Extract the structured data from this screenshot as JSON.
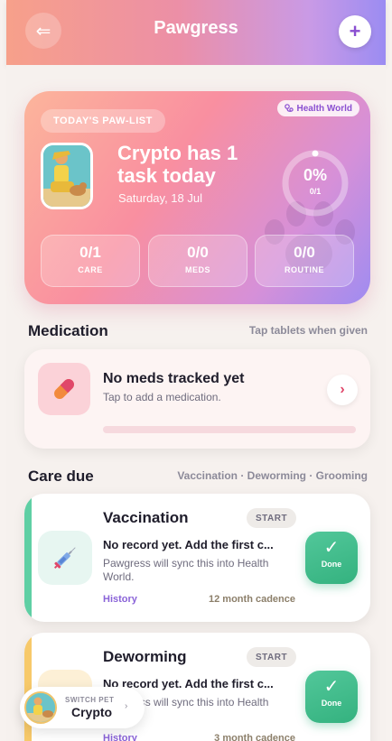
{
  "header": {
    "title": "Pawgress",
    "back_icon": "arrow-left-icon",
    "add_icon": "plus-icon",
    "add_label": "+"
  },
  "hero": {
    "pill": "TODAY'S PAW-LIST",
    "badge": "Health World",
    "title": "Crypto has 1 task today",
    "date": "Saturday, 18 Jul",
    "progress_pct": "0%",
    "progress_sub": "0/1",
    "progress_fraction": 0,
    "stats": [
      {
        "value": "0/1",
        "label": "CARE"
      },
      {
        "value": "0/0",
        "label": "MEDS"
      },
      {
        "value": "0/0",
        "label": "ROUTINE"
      }
    ]
  },
  "medication": {
    "section_title": "Medication",
    "section_hint": "Tap tablets when given",
    "card_title": "No meds tracked yet",
    "card_sub": "Tap to add a medication.",
    "chevron": "›"
  },
  "care": {
    "section_title": "Care due",
    "section_hint": "Vaccination · Deworming · Grooming",
    "items": [
      {
        "title": "Vaccination",
        "status": "START",
        "line1": "No record yet. Add the first c...",
        "line2": "Pawgress will sync this into Health World.",
        "history": "History",
        "cadence": "12 month cadence",
        "done": "Done",
        "tick": "✓",
        "icon": "syringe-icon",
        "accent": "#5fcfa4"
      },
      {
        "title": "Deworming",
        "status": "START",
        "line1": "No record yet. Add the first c...",
        "line2": "Pawgress will sync this into Health World.",
        "history": "History",
        "cadence": "3 month cadence",
        "done": "Done",
        "tick": "✓",
        "icon": "deworm-icon",
        "accent": "#f7c96a"
      }
    ]
  },
  "switch_pet": {
    "label": "SWITCH PET",
    "name": "Crypto",
    "chevron": "›"
  },
  "colors": {
    "accent_purple": "#8a4fd1",
    "done_green": "#34b27f",
    "pill_red": "#e0476a"
  }
}
